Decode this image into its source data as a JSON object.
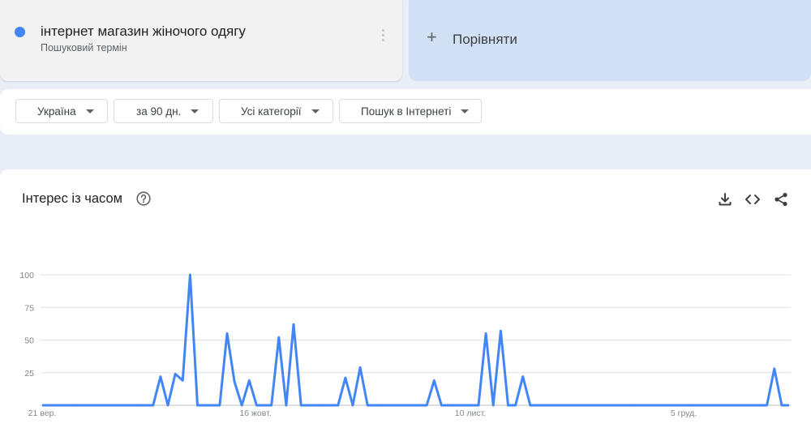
{
  "search_term": {
    "title": "інтернет магазин жіночого одягу",
    "subtitle": "Пошуковий термін",
    "color": "#4285f4"
  },
  "compare": {
    "icon": "plus-icon",
    "label": "Порівняти"
  },
  "filters": [
    {
      "label": "Україна"
    },
    {
      "label": "за 90 дн."
    },
    {
      "label": "Усі категорії"
    },
    {
      "label": "Пошук в Інтернеті"
    }
  ],
  "chart_section": {
    "title": "Інтерес із часом",
    "icons": [
      "help-icon",
      "download-icon",
      "embed-icon",
      "share-icon"
    ]
  },
  "chart_data": {
    "type": "line",
    "title": "",
    "xlabel": "",
    "ylabel": "",
    "ylim": [
      0,
      100
    ],
    "yticks": [
      "100",
      "75",
      "50",
      "25"
    ],
    "x_tick_labels": [
      "21 вер.",
      "16 жовт.",
      "10 лист.",
      "5 груд."
    ],
    "grid": true,
    "series_color": "#4285f4",
    "series": [
      {
        "values": [
          0,
          0,
          0,
          0,
          0,
          0,
          0,
          0,
          0,
          0,
          0,
          0,
          0,
          0,
          0,
          0,
          22,
          0,
          24,
          19,
          100,
          0,
          0,
          0,
          0,
          55,
          18,
          0,
          19,
          0,
          0,
          0,
          52,
          0,
          62,
          0,
          0,
          0,
          0,
          0,
          0,
          21,
          0,
          29,
          0,
          0,
          0,
          0,
          0,
          0,
          0,
          0,
          0,
          19,
          0,
          0,
          0,
          0,
          0,
          0,
          55,
          0,
          57,
          0,
          0,
          22,
          0,
          0,
          0,
          0,
          0,
          0,
          0,
          0,
          0,
          0,
          0,
          0,
          0,
          0,
          0,
          0,
          0,
          0,
          0,
          0,
          0,
          0,
          0,
          0,
          0,
          0,
          0,
          0,
          0,
          0,
          0,
          0,
          0,
          28,
          0,
          0
        ]
      }
    ]
  }
}
